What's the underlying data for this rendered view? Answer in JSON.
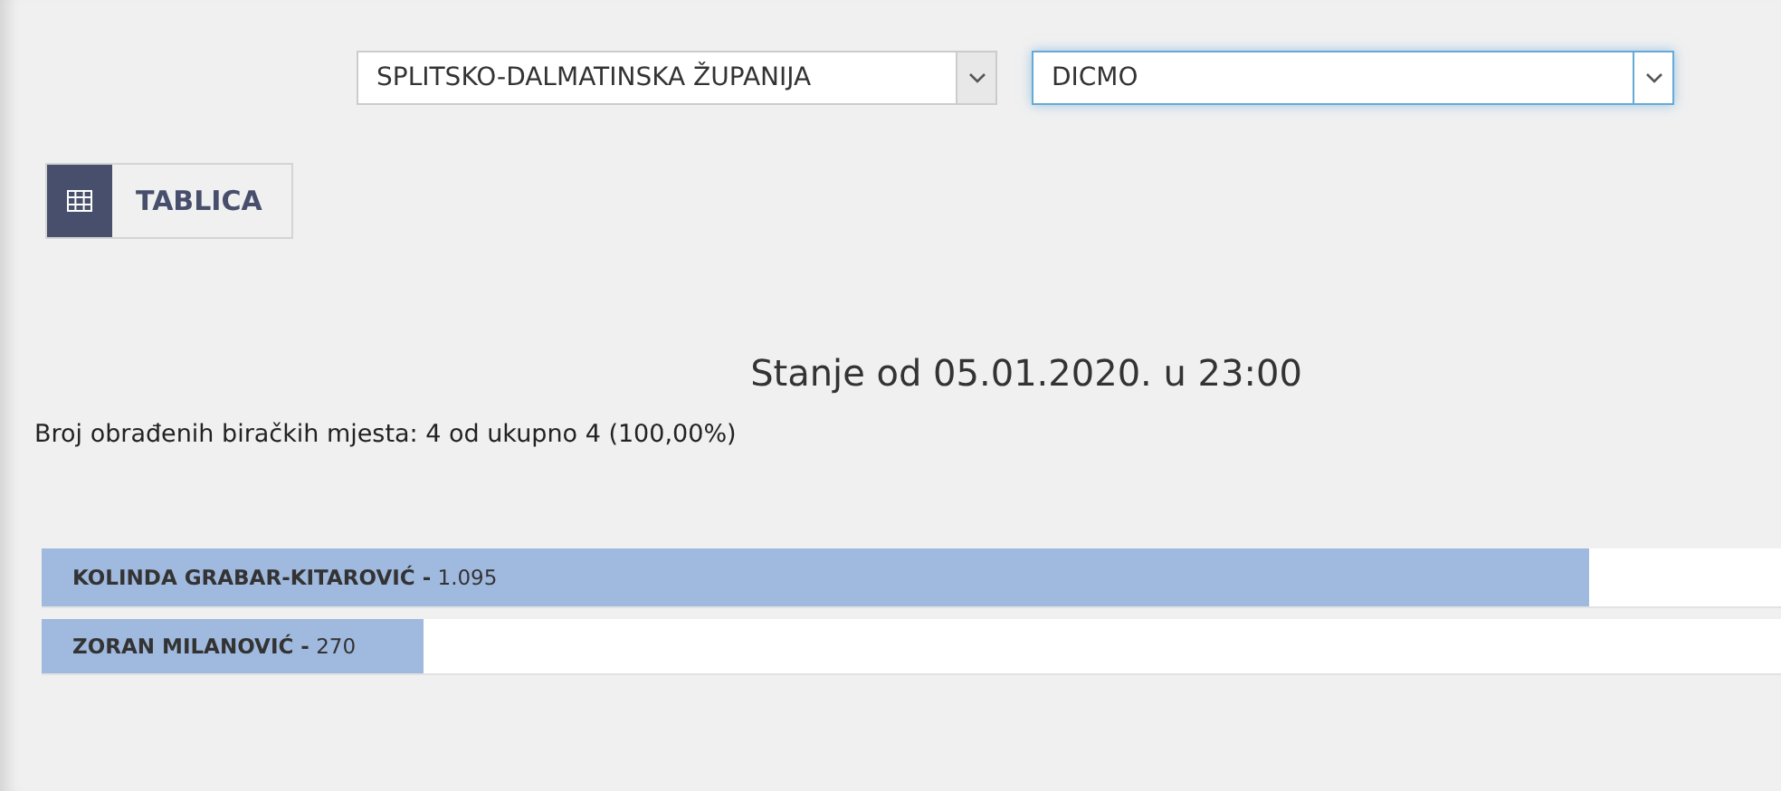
{
  "filters": [
    {
      "value": "SPLITSKO-DALMATINSKA ŽUPANIJA",
      "focused": false
    },
    {
      "value": "DICMO",
      "focused": true
    }
  ],
  "view_button": {
    "label": "TABLICA"
  },
  "title": "Stanje od 05.01.2020. u 23:00",
  "summary": "Broj obrađenih biračkih mjesta: 4 od ukupno 4 (100,00%)",
  "results": [
    {
      "label": "**KOLINDA GRABAR-KITAROVIĆ -** 1.095",
      "level": 0.89
    },
    {
      "label": "**ZORAN MILANOVIĆ -** 270",
      "level": 0.22
    }
  ]
}
